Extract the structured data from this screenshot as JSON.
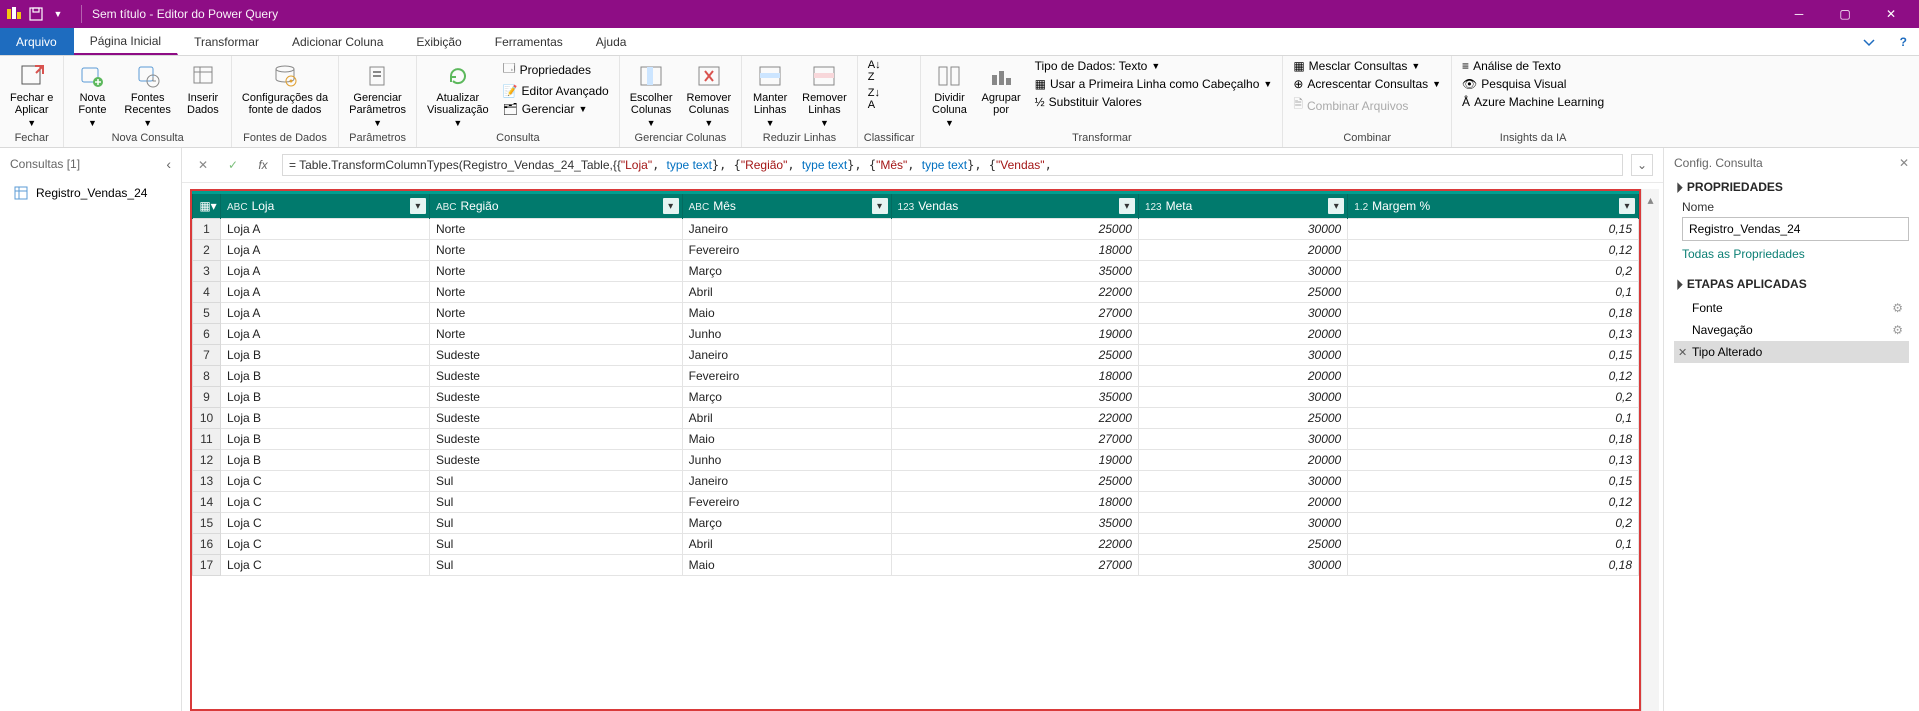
{
  "title": "Sem título - Editor do Power Query",
  "tabs": {
    "file": "Arquivo",
    "items": [
      "Página Inicial",
      "Transformar",
      "Adicionar Coluna",
      "Exibição",
      "Ferramentas",
      "Ajuda"
    ]
  },
  "ribbon": {
    "close": {
      "btn": "Fechar e\nAplicar",
      "group": "Fechar"
    },
    "newquery": {
      "a": "Nova\nFonte",
      "b": "Fontes\nRecentes",
      "c": "Inserir\nDados",
      "group": "Nova Consulta"
    },
    "datasrc": {
      "a": "Configurações da\nfonte de dados",
      "group": "Fontes de Dados"
    },
    "params": {
      "a": "Gerenciar\nParâmetros",
      "group": "Parâmetros"
    },
    "query": {
      "refresh": "Atualizar\nVisualização",
      "props": "Propriedades",
      "adv": "Editor Avançado",
      "manage": "Gerenciar",
      "group": "Consulta"
    },
    "mcols": {
      "choose": "Escolher\nColunas",
      "remove": "Remover\nColunas",
      "group": "Gerenciar Colunas"
    },
    "rrows": {
      "keep": "Manter\nLinhas",
      "remove": "Remover\nLinhas",
      "group": "Reduzir Linhas"
    },
    "sort": {
      "group": "Classificar"
    },
    "transform": {
      "split": "Dividir\nColuna",
      "group_btn": "Agrupar\npor",
      "dtype": "Tipo de Dados: Texto",
      "firstrow": "Usar a Primeira Linha como Cabeçalho",
      "replace": "Substituir Valores",
      "group": "Transformar"
    },
    "combine": {
      "merge": "Mesclar Consultas",
      "append": "Acrescentar Consultas",
      "files": "Combinar Arquivos",
      "group": "Combinar"
    },
    "ai": {
      "text": "Análise de Texto",
      "vision": "Pesquisa Visual",
      "ml": "Azure Machine Learning",
      "group": "Insights da IA"
    }
  },
  "queries": {
    "title": "Consultas [1]",
    "items": [
      "Registro_Vendas_24"
    ]
  },
  "formula": {
    "prefix": "= Table.TransformColumnTypes(Registro_Vendas_24_Table,{{",
    "s1": "\"Loja\"",
    "t1": "type text",
    "s2": "\"Região\"",
    "t2": "type text",
    "s3": "\"Mês\"",
    "t3": "type text",
    "s4": "\"Vendas\""
  },
  "columns": [
    {
      "name": "Loja",
      "type": "ABC"
    },
    {
      "name": "Região",
      "type": "ABC"
    },
    {
      "name": "Mês",
      "type": "ABC"
    },
    {
      "name": "Vendas",
      "type": "123"
    },
    {
      "name": "Meta",
      "type": "123"
    },
    {
      "name": "Margem %",
      "type": "1.2"
    }
  ],
  "rows": [
    [
      "Loja A",
      "Norte",
      "Janeiro",
      "25000",
      "30000",
      "0,15"
    ],
    [
      "Loja A",
      "Norte",
      "Fevereiro",
      "18000",
      "20000",
      "0,12"
    ],
    [
      "Loja A",
      "Norte",
      "Março",
      "35000",
      "30000",
      "0,2"
    ],
    [
      "Loja A",
      "Norte",
      "Abril",
      "22000",
      "25000",
      "0,1"
    ],
    [
      "Loja A",
      "Norte",
      "Maio",
      "27000",
      "30000",
      "0,18"
    ],
    [
      "Loja A",
      "Norte",
      "Junho",
      "19000",
      "20000",
      "0,13"
    ],
    [
      "Loja B",
      "Sudeste",
      "Janeiro",
      "25000",
      "30000",
      "0,15"
    ],
    [
      "Loja B",
      "Sudeste",
      "Fevereiro",
      "18000",
      "20000",
      "0,12"
    ],
    [
      "Loja B",
      "Sudeste",
      "Março",
      "35000",
      "30000",
      "0,2"
    ],
    [
      "Loja B",
      "Sudeste",
      "Abril",
      "22000",
      "25000",
      "0,1"
    ],
    [
      "Loja B",
      "Sudeste",
      "Maio",
      "27000",
      "30000",
      "0,18"
    ],
    [
      "Loja B",
      "Sudeste",
      "Junho",
      "19000",
      "20000",
      "0,13"
    ],
    [
      "Loja C",
      "Sul",
      "Janeiro",
      "25000",
      "30000",
      "0,15"
    ],
    [
      "Loja C",
      "Sul",
      "Fevereiro",
      "18000",
      "20000",
      "0,12"
    ],
    [
      "Loja C",
      "Sul",
      "Março",
      "35000",
      "30000",
      "0,2"
    ],
    [
      "Loja C",
      "Sul",
      "Abril",
      "22000",
      "25000",
      "0,1"
    ],
    [
      "Loja C",
      "Sul",
      "Maio",
      "27000",
      "30000",
      "0,18"
    ]
  ],
  "settings": {
    "title": "Config. Consulta",
    "properties": "PROPRIEDADES",
    "name_label": "Nome",
    "name_value": "Registro_Vendas_24",
    "all_props": "Todas as Propriedades",
    "steps_title": "ETAPAS APLICADAS",
    "steps": [
      "Fonte",
      "Navegação",
      "Tipo Alterado"
    ]
  }
}
